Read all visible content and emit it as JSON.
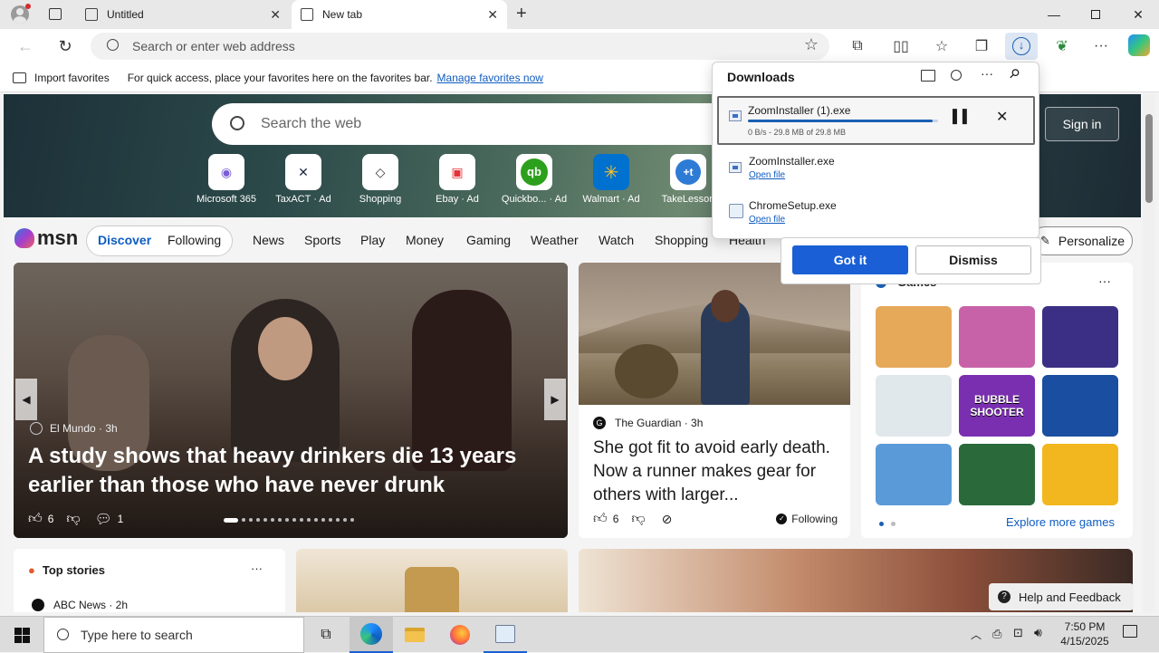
{
  "browser": {
    "tabs": [
      {
        "title": "Untitled",
        "active": false
      },
      {
        "title": "New tab",
        "active": true
      }
    ],
    "address_placeholder": "Search or enter web address",
    "favorites_bar": {
      "import_label": "Import favorites",
      "hint_text": "For quick access, place your favorites here on the favorites bar.",
      "manage_link": "Manage favorites now"
    }
  },
  "downloads": {
    "title": "Downloads",
    "items": [
      {
        "name": "ZoomInstaller (1).exe",
        "status": "0 B/s - 29.8 MB of 29.8 MB",
        "progress": 0.97
      },
      {
        "name": "ZoomInstaller.exe",
        "action": "Open file"
      },
      {
        "name": "ChromeSetup.exe",
        "action": "Open file"
      }
    ],
    "got_it": "Got it",
    "dismiss": "Dismiss"
  },
  "msn": {
    "search_placeholder": "Search the web",
    "sign_in": "Sign in",
    "quick_links": [
      {
        "label": "Microsoft 365",
        "color": "#7b5cd6"
      },
      {
        "label": "TaxACT · Ad",
        "color": "#1c2a45"
      },
      {
        "label": "Shopping",
        "color": "#333333"
      },
      {
        "label": "Ebay · Ad",
        "color": "#e53238"
      },
      {
        "label": "Quickbo... · Ad",
        "color": "#2ca01c"
      },
      {
        "label": "Walmart · Ad",
        "color": "#0071ce"
      },
      {
        "label": "TakeLesson",
        "color": "#2e7bd6"
      }
    ],
    "logo": "msn",
    "nav_pills": [
      "Discover",
      "Following"
    ],
    "nav": [
      "News",
      "Sports",
      "Play",
      "Money",
      "Gaming",
      "Weather",
      "Watch",
      "Shopping",
      "Health"
    ],
    "personalize": "Personalize",
    "hero_story": {
      "source": "El Mundo · 3h",
      "headline": "A study shows that heavy drinkers die 13 years earlier than those who have never drunk",
      "likes": "6",
      "comments": "1"
    },
    "side_story": {
      "source": "The Guardian · 3h",
      "headline": "She got fit to avoid early death. Now a runner makes gear for others with larger...",
      "likes": "6",
      "following": "Following"
    },
    "games": {
      "title": "Games",
      "more": "Explore more games",
      "tile_colors": [
        "#e6a95a",
        "#c862a8",
        "#3a2f84",
        "#e0e8ec",
        "#7a2fb0",
        "#1a4ea0",
        "#5a9ad8",
        "#2a6a3a",
        "#f2b71e"
      ],
      "bubble_label": "BUBBLE SHOOTER"
    },
    "top_stories": {
      "title": "Top stories",
      "first_source": "ABC News · 2h"
    },
    "help": "Help and Feedback"
  },
  "taskbar": {
    "search_placeholder": "Type here to search",
    "time": "7:50 PM",
    "date": "4/15/2025"
  }
}
